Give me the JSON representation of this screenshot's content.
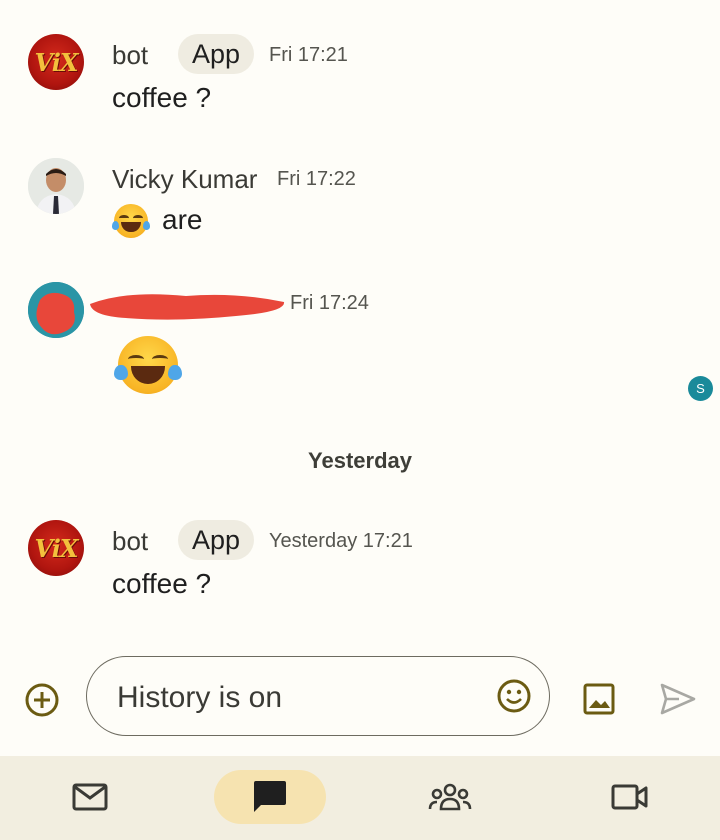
{
  "messages": [
    {
      "sender": "bot",
      "chip": "App",
      "time": "Fri 17:21",
      "text": "coffee ?"
    },
    {
      "sender": "Vicky Kumar",
      "time": "Fri 17:22",
      "text": "are"
    },
    {
      "sender": "",
      "time": "Fri 17:24"
    },
    {
      "sender": "bot",
      "chip": "App",
      "time": "Yesterday 17:21",
      "text": "coffee ?"
    }
  ],
  "avatars": {
    "bot": "ViX"
  },
  "date_separator": "Yesterday",
  "read_badge": "S",
  "composer": {
    "placeholder": "History is on"
  },
  "colors": {
    "accent": "#6b5b12",
    "nav_active_bg": "#f6e3b0",
    "redaction": "#e8473a",
    "badge": "#1a8a9a"
  }
}
